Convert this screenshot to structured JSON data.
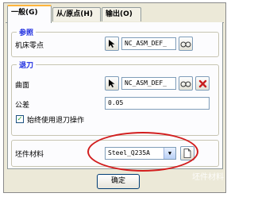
{
  "tabs": [
    {
      "label": "一般(G)",
      "active": true
    },
    {
      "label": "从/原点(H)",
      "active": false
    },
    {
      "label": "输出(O)",
      "active": false
    }
  ],
  "params": {
    "title": "参照",
    "machine_zero_label": "机床零点",
    "machine_zero_value": "NC_ASM_DEF_"
  },
  "retract": {
    "title": "退刀",
    "surface_label": "曲面",
    "surface_value": "NC_ASM_DEF_",
    "tolerance_label": "公差",
    "tolerance_value": "0.05",
    "always_retract_label": "始终使用退刀操作",
    "always_retract_checked": true
  },
  "stock": {
    "material_label": "坯件材料",
    "material_value": "Steel_Q235A"
  },
  "ok_label": "确定",
  "watermark": "坯件材料",
  "colors": {
    "group_title": "#1d2ce0",
    "highlight": "#d21e1e"
  }
}
